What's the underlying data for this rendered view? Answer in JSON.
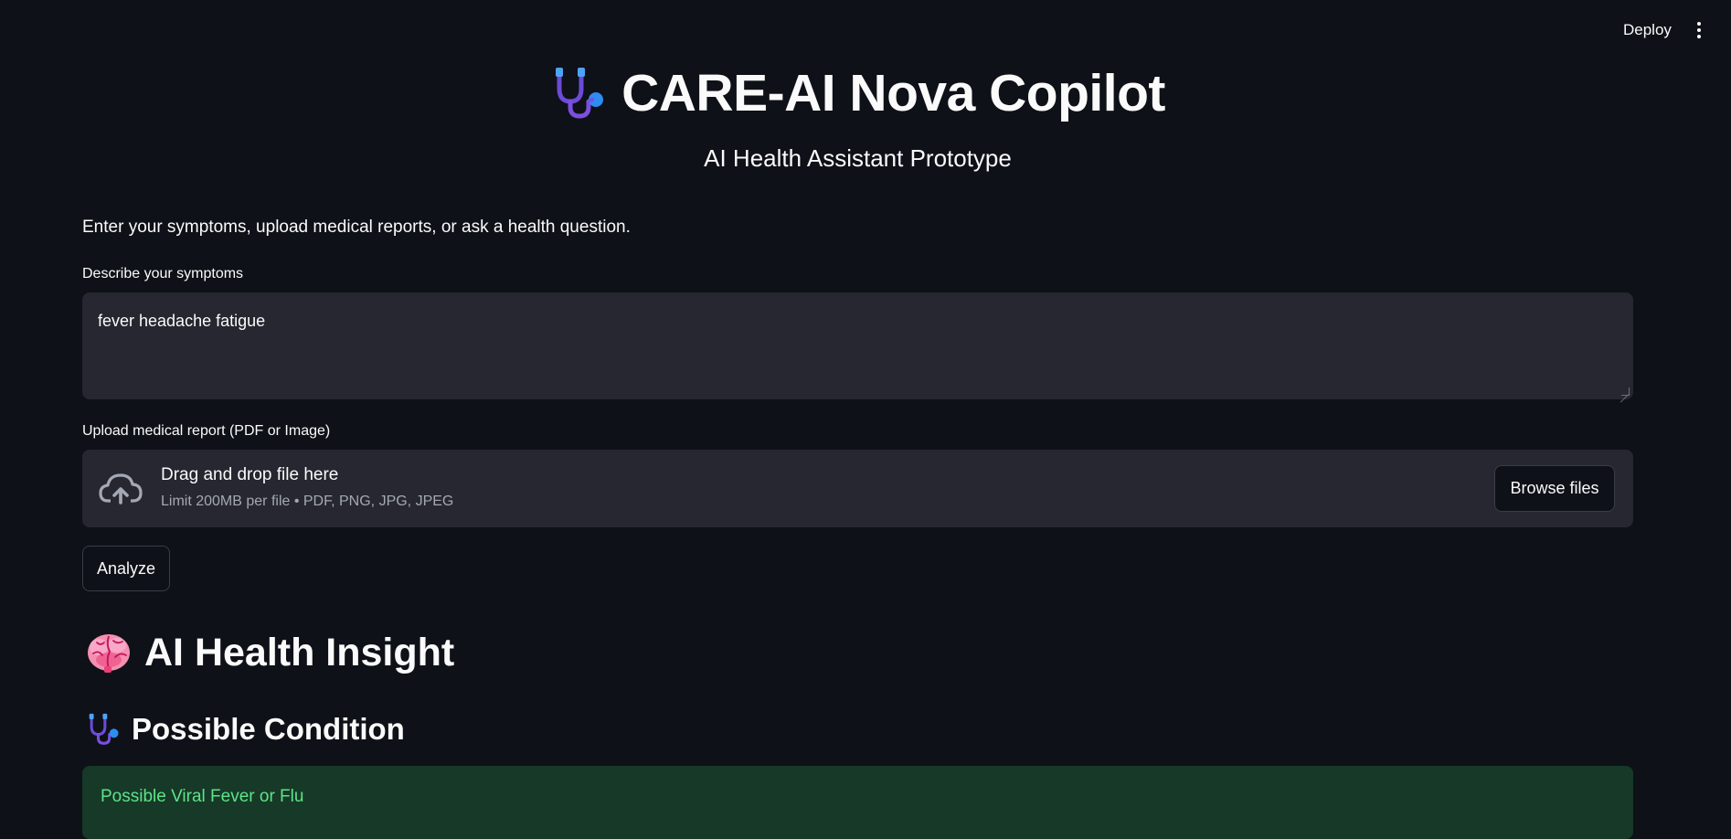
{
  "header": {
    "deploy_label": "Deploy",
    "menu_icon": "kebab-menu-icon"
  },
  "hero": {
    "title": "CARE-AI Nova Copilot",
    "title_icon": "stethoscope-icon",
    "subtitle": "AI Health Assistant Prototype"
  },
  "intro": "Enter your symptoms, upload medical reports, or ask a health question.",
  "symptoms": {
    "label": "Describe your symptoms",
    "value": "fever headache fatigue"
  },
  "upload": {
    "label": "Upload medical report (PDF or Image)",
    "dropzone_title": "Drag and drop file here",
    "dropzone_hint": "Limit 200MB per file • PDF, PNG, JPG, JPEG",
    "browse_label": "Browse files",
    "icon": "cloud-upload-icon"
  },
  "analyze_label": "Analyze",
  "insight": {
    "title": "AI Health Insight",
    "title_icon": "brain-icon"
  },
  "condition": {
    "title": "Possible Condition",
    "title_icon": "stethoscope-icon",
    "result": "Possible Viral Fever or Flu"
  },
  "colors": {
    "background": "#0e1117",
    "input_bg": "#262730",
    "success_bg": "#173928",
    "success_text": "#5ce488"
  }
}
